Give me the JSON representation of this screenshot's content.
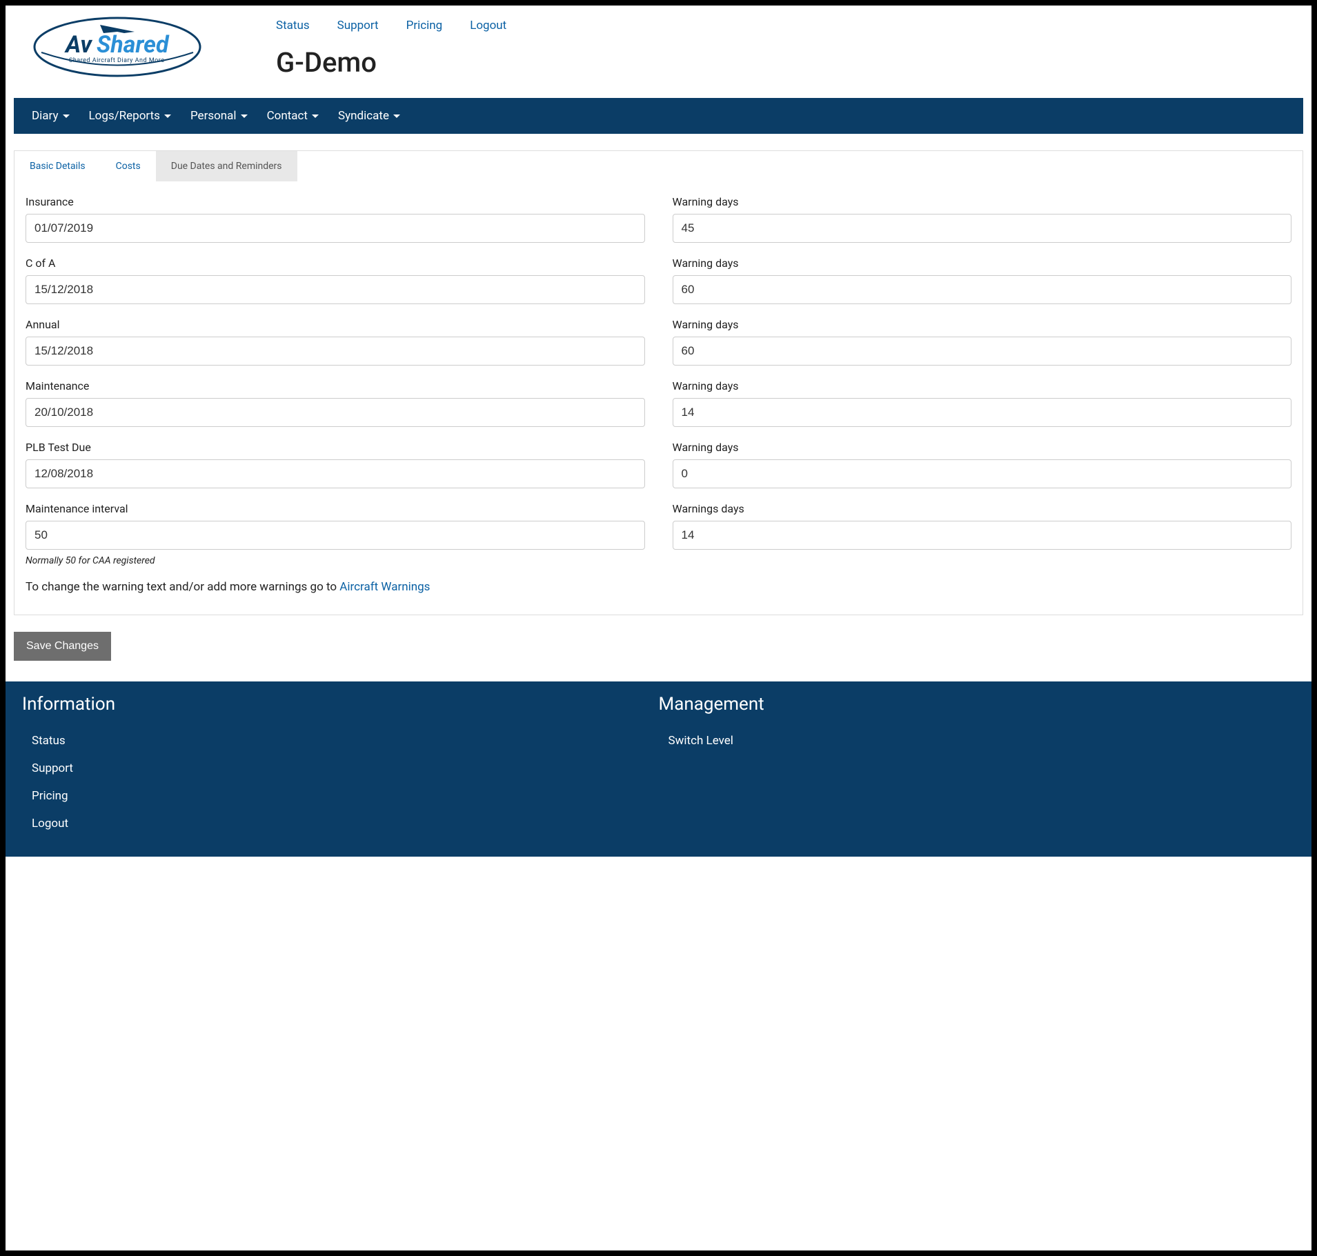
{
  "header": {
    "topLinks": [
      "Status",
      "Support",
      "Pricing",
      "Logout"
    ],
    "title": "G-Demo",
    "logo": {
      "text1": "Av",
      "text2": "Shared",
      "tag": "Shared Aircraft Diary And More"
    }
  },
  "nav": [
    "Diary",
    "Logs/Reports",
    "Personal",
    "Contact",
    "Syndicate"
  ],
  "tabs": [
    "Basic Details",
    "Costs",
    "Due Dates and Reminders"
  ],
  "form": {
    "rows": [
      {
        "leftLabel": "Insurance",
        "leftValue": "01/07/2019",
        "rightLabel": "Warning days",
        "rightValue": "45"
      },
      {
        "leftLabel": "C of A",
        "leftValue": "15/12/2018",
        "rightLabel": "Warning days",
        "rightValue": "60"
      },
      {
        "leftLabel": "Annual",
        "leftValue": "15/12/2018",
        "rightLabel": "Warning days",
        "rightValue": "60"
      },
      {
        "leftLabel": "Maintenance",
        "leftValue": "20/10/2018",
        "rightLabel": "Warning days",
        "rightValue": "14"
      },
      {
        "leftLabel": "PLB Test Due",
        "leftValue": "12/08/2018",
        "rightLabel": "Warning days",
        "rightValue": "0"
      },
      {
        "leftLabel": "Maintenance interval",
        "leftValue": "50",
        "rightLabel": "Warnings days",
        "rightValue": "14",
        "help": "Normally 50 for CAA registered"
      }
    ],
    "notePrefix": "To change the warning text and/or add more warnings go to ",
    "noteLink": "Aircraft Warnings",
    "saveLabel": "Save Changes"
  },
  "footer": {
    "infoTitle": "Information",
    "infoLinks": [
      "Status",
      "Support",
      "Pricing",
      "Logout"
    ],
    "mgmtTitle": "Management",
    "mgmtLinks": [
      "Switch Level"
    ]
  }
}
